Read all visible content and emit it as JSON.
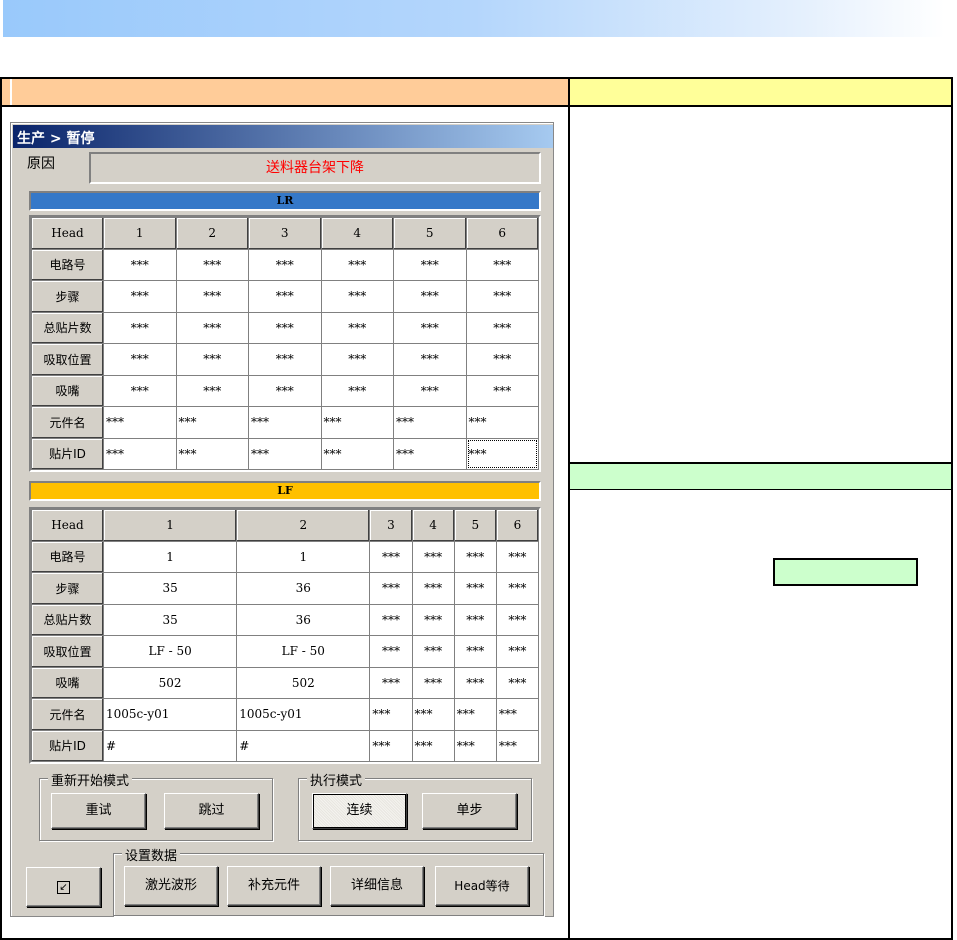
{
  "dialog": {
    "title": "生产 > 暂停",
    "reason_label": "原因",
    "reason_value": "送料器台架下降",
    "lr": {
      "label": "LR",
      "header": [
        "Head",
        "1",
        "2",
        "3",
        "4",
        "5",
        "6"
      ],
      "rows": [
        {
          "label": "电路号",
          "cells": [
            "***",
            "***",
            "***",
            "***",
            "***",
            "***"
          ]
        },
        {
          "label": "步骤",
          "cells": [
            "***",
            "***",
            "***",
            "***",
            "***",
            "***"
          ]
        },
        {
          "label": "总贴片数",
          "cells": [
            "***",
            "***",
            "***",
            "***",
            "***",
            "***"
          ]
        },
        {
          "label": "吸取位置",
          "cells": [
            "***",
            "***",
            "***",
            "***",
            "***",
            "***"
          ]
        },
        {
          "label": "吸嘴",
          "cells": [
            "***",
            "***",
            "***",
            "***",
            "***",
            "***"
          ]
        },
        {
          "label": "元件名",
          "cells": [
            "***",
            "***",
            "***",
            "***",
            "***",
            "***"
          ]
        },
        {
          "label": "贴片ID",
          "cells": [
            "***",
            "***",
            "***",
            "***",
            "***",
            "***"
          ]
        }
      ]
    },
    "lf": {
      "label": "LF",
      "header": [
        "Head",
        "1",
        "2",
        "3",
        "4",
        "5",
        "6"
      ],
      "rows": [
        {
          "label": "电路号",
          "cells": [
            "1",
            "1",
            "***",
            "***",
            "***",
            "***"
          ]
        },
        {
          "label": "步骤",
          "cells": [
            "35",
            "36",
            "***",
            "***",
            "***",
            "***"
          ]
        },
        {
          "label": "总贴片数",
          "cells": [
            "35",
            "36",
            "***",
            "***",
            "***",
            "***"
          ]
        },
        {
          "label": "吸取位置",
          "cells": [
            "LF - 50",
            "LF - 50",
            "***",
            "***",
            "***",
            "***"
          ]
        },
        {
          "label": "吸嘴",
          "cells": [
            "502",
            "502",
            "***",
            "***",
            "***",
            "***"
          ]
        },
        {
          "label": "元件名",
          "cells": [
            "1005c-y01",
            "1005c-y01",
            "***",
            "***",
            "***",
            "***"
          ]
        },
        {
          "label": "贴片ID",
          "cells": [
            "#",
            "#",
            "***",
            "***",
            "***",
            "***"
          ]
        }
      ]
    },
    "restart_mode": {
      "label": "重新开始模式",
      "retry": "重试",
      "skip": "跳过"
    },
    "exec_mode": {
      "label": "执行模式",
      "continuous": "连续",
      "step": "单步"
    },
    "settings": {
      "label": "设置数据",
      "laser": "激光波形",
      "supply": "补充元件",
      "detail": "详细信息",
      "head_wait": "Head等待"
    }
  },
  "colors": {
    "lr_bar": "#3578c8",
    "lf_bar": "#ffc000",
    "header_left": "#ffcc99",
    "header_right": "#ffff99",
    "green": "#ccffcc"
  }
}
